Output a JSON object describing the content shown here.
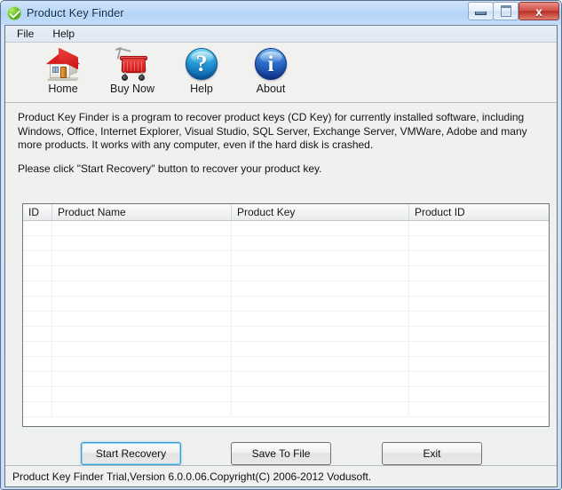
{
  "window": {
    "title": "Product Key Finder",
    "app_icon": "green-check-circle-icon",
    "controls": {
      "minimize": "minimize-icon",
      "maximize": "maximize-icon",
      "close": "x"
    }
  },
  "menubar": {
    "items": [
      {
        "label": "File"
      },
      {
        "label": "Help"
      }
    ]
  },
  "toolbar": {
    "items": [
      {
        "label": "Home",
        "icon": "house-icon"
      },
      {
        "label": "Buy Now",
        "icon": "shopping-cart-icon"
      },
      {
        "label": "Help",
        "icon": "question-mark-circle-icon",
        "glyph": "?"
      },
      {
        "label": "About",
        "icon": "info-circle-icon",
        "glyph": "i"
      }
    ]
  },
  "description": {
    "paragraph1": "Product Key Finder is a program to recover product keys (CD Key) for currently installed software, including Windows, Office, Internet Explorer, Visual Studio, SQL Server, Exchange Server, VMWare, Adobe and many more products. It works with any computer, even if the hard disk is crashed.",
    "paragraph2": "Please click \"Start Recovery\" button to recover your product key."
  },
  "table": {
    "columns": [
      "ID",
      "Product Name",
      "Product Key",
      "Product ID"
    ],
    "rows": [],
    "empty_row_count": 13
  },
  "buttons": {
    "start_recovery": "Start Recovery",
    "save_to_file": "Save To File",
    "exit": "Exit"
  },
  "statusbar": {
    "text": "Product Key Finder Trial,Version 6.0.0.06.Copyright(C) 2006-2012 Vodusoft."
  },
  "colors": {
    "titlebar": "#bcd8f8",
    "window_border": "#5a708c",
    "client_background": "#eff0f0",
    "focus_ring": "#3c9fd4",
    "close_button": "#c0392b"
  }
}
